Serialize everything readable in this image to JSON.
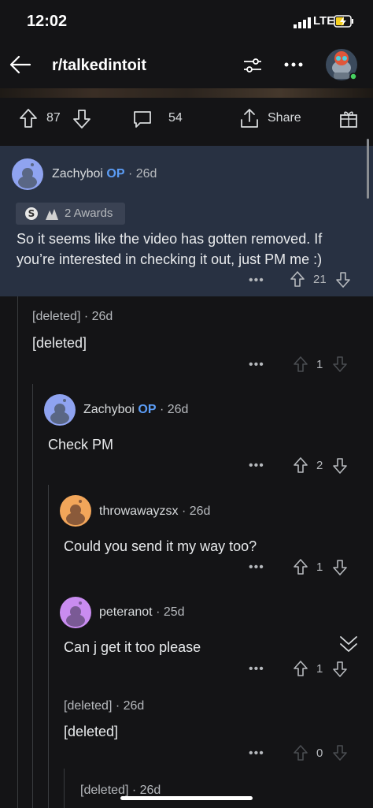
{
  "status": {
    "time": "12:02",
    "network": "LTE"
  },
  "header": {
    "title": "r/talkedintoit"
  },
  "post_actions": {
    "upvotes": "87",
    "comments": "54",
    "share_label": "Share"
  },
  "comments": [
    {
      "author": "Zachyboi",
      "op_label": "OP",
      "age": "26d",
      "awards_label": "2 Awards",
      "text": "So it seems like the video has gotten removed. If you’re interested in checking it out, just PM me :)",
      "score": "21",
      "avatar_color": "#8fa3f0"
    },
    {
      "author": "[deleted]",
      "age": "26d",
      "text": "[deleted]",
      "score": "1"
    },
    {
      "author": "Zachyboi",
      "op_label": "OP",
      "age": "26d",
      "text": "Check PM",
      "score": "2",
      "avatar_color": "#8fa3f0"
    },
    {
      "author": "throwawayzsx",
      "age": "26d",
      "text": "Could you send it my way too?",
      "score": "1",
      "avatar_color": "#f2a65a"
    },
    {
      "author": "peteranot",
      "age": "25d",
      "text": "Can j get it too please",
      "score": "1",
      "avatar_color": "#c98cf0"
    },
    {
      "author": "[deleted]",
      "age": "26d",
      "text": "[deleted]",
      "score": "0"
    },
    {
      "author": "[deleted]",
      "age": "26d"
    }
  ],
  "sep": "·",
  "more_dots": "•••"
}
